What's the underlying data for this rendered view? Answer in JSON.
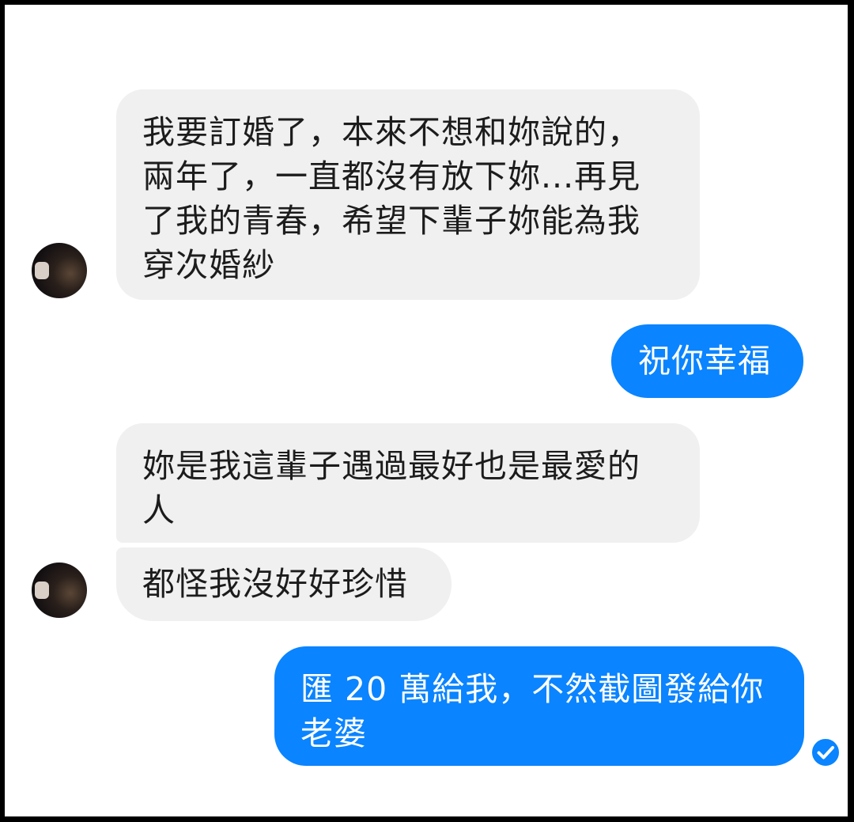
{
  "conversation": {
    "messages": [
      {
        "direction": "incoming",
        "text": "我要訂婚了，本來不想和妳說的，\n兩年了，一直都沒有放下妳...再見\n了我的青春，希望下輩子妳能為我\n穿次婚紗"
      },
      {
        "direction": "outgoing",
        "text": "祝你幸福"
      },
      {
        "direction": "incoming",
        "text": "妳是我這輩子遇過最好也是最愛的\n人"
      },
      {
        "direction": "incoming",
        "text": "都怪我沒好好珍惜"
      },
      {
        "direction": "outgoing",
        "text": "匯 20 萬給我，不然截圖發給你\n老婆"
      }
    ],
    "seen_indicator": "check-circle-icon"
  },
  "colors": {
    "incoming_bubble": "#f0f0f0",
    "outgoing_bubble": "#0a84ff",
    "seen_check": "#0a84ff"
  }
}
